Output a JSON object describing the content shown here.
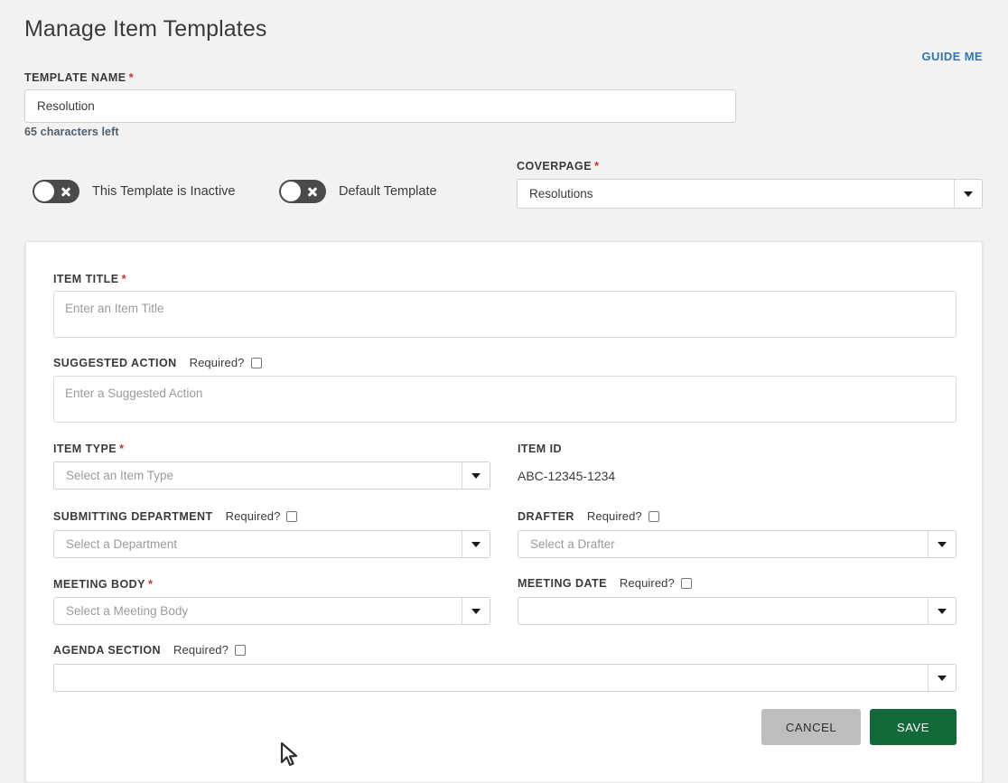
{
  "header": {
    "title": "Manage Item Templates",
    "guide_me": "GUIDE ME"
  },
  "template_name": {
    "label": "TEMPLATE NAME",
    "required": true,
    "value": "Resolution",
    "helper": "65 characters left"
  },
  "toggles": [
    {
      "name": "inactive-toggle",
      "label": "This Template is Inactive",
      "state": "off",
      "icon": "x-icon"
    },
    {
      "name": "default-template-toggle",
      "label": "Default Template",
      "state": "off",
      "icon": "x-icon"
    }
  ],
  "coverpage": {
    "label": "COVERPAGE",
    "required": true,
    "value": "Resolutions"
  },
  "item_title": {
    "label": "ITEM TITLE",
    "required": true,
    "placeholder": "Enter an Item Title",
    "value": ""
  },
  "suggested_action": {
    "label": "SUGGESTED ACTION",
    "required_label": "Required?",
    "required_checked": false,
    "placeholder": "Enter a Suggested Action",
    "value": ""
  },
  "item_type": {
    "label": "ITEM TYPE",
    "required": true,
    "placeholder": "Select an Item Type",
    "value": ""
  },
  "item_id": {
    "label": "ITEM ID",
    "value": "ABC-12345-1234"
  },
  "submitting_department": {
    "label": "SUBMITTING DEPARTMENT",
    "required_label": "Required?",
    "required_checked": false,
    "placeholder": "Select a Department",
    "value": ""
  },
  "drafter": {
    "label": "DRAFTER",
    "required_label": "Required?",
    "required_checked": false,
    "placeholder": "Select a Drafter",
    "value": ""
  },
  "meeting_body": {
    "label": "MEETING BODY",
    "required": true,
    "placeholder": "Select a Meeting Body",
    "value": ""
  },
  "meeting_date": {
    "label": "MEETING DATE",
    "required_label": "Required?",
    "required_checked": false,
    "placeholder": "",
    "value": ""
  },
  "agenda_section": {
    "label": "AGENDA SECTION",
    "required_label": "Required?",
    "required_checked": false,
    "placeholder": "",
    "value": ""
  },
  "actions": {
    "cancel": "CANCEL",
    "save": "SAVE"
  },
  "colors": {
    "page_bg": "#f2f2f2",
    "card_bg": "#ffffff",
    "link": "#3574ac",
    "required_star": "#c0392b",
    "save_bg": "#14693a",
    "cancel_bg": "#bdbdbd",
    "toggle_off_bg": "#4b4b4b"
  },
  "cursor": {
    "icon": "mouse-pointer-icon"
  }
}
